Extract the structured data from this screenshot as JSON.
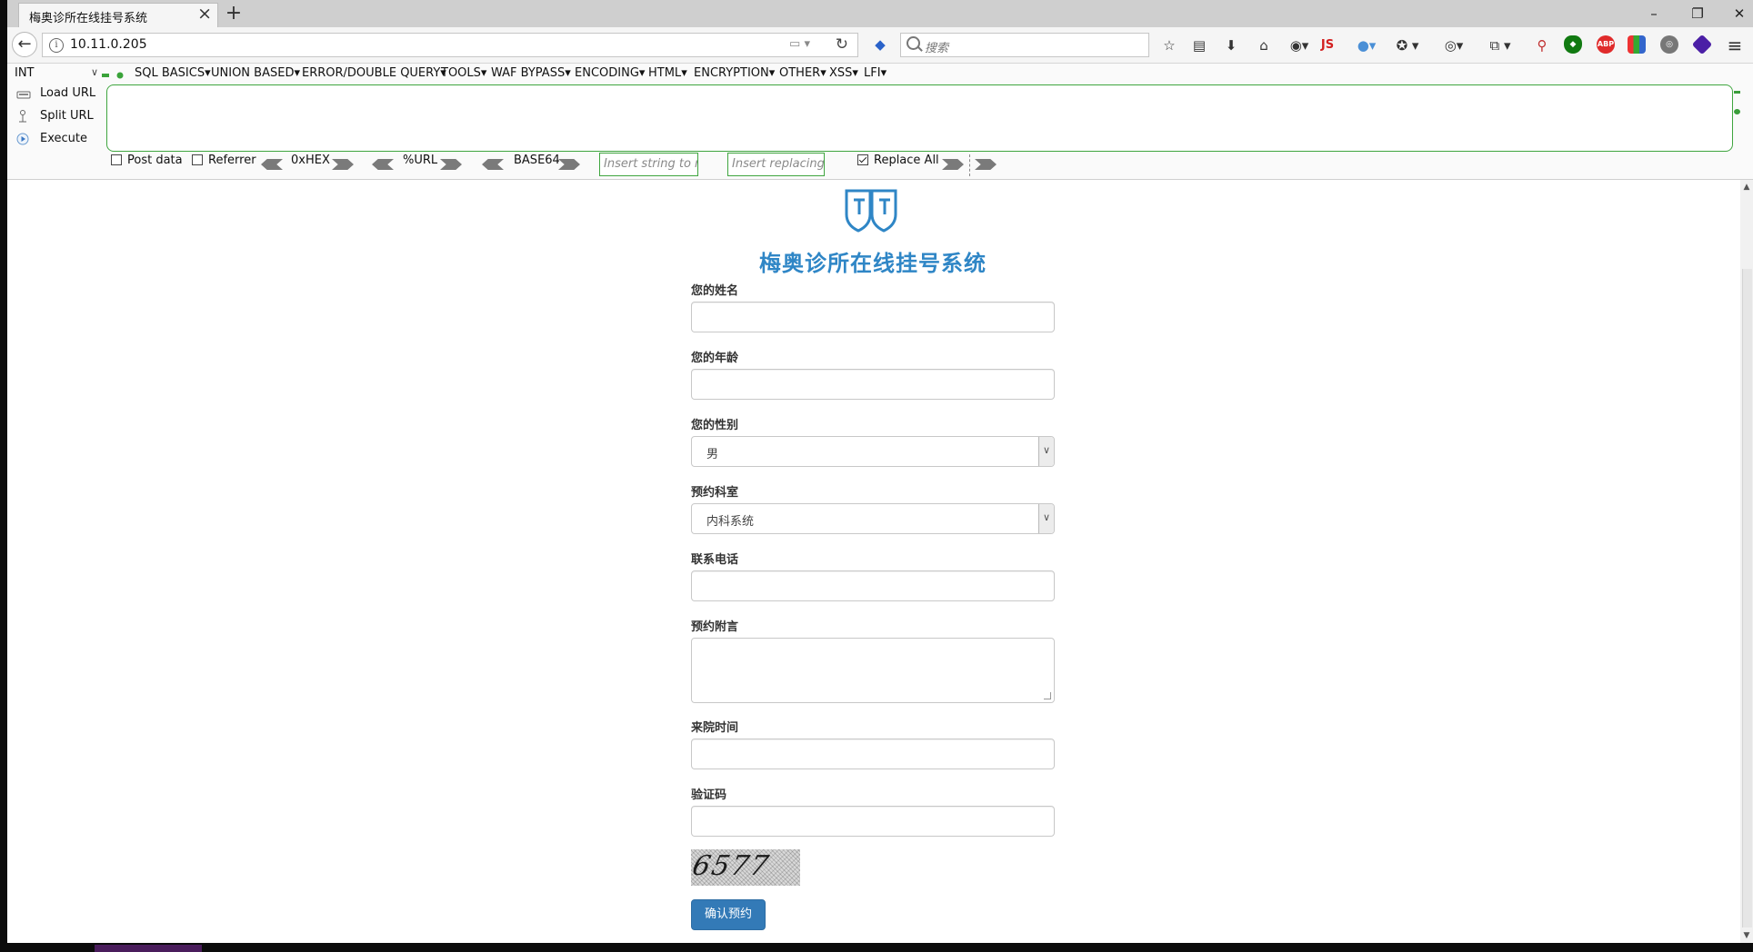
{
  "tab": {
    "title": "梅奥诊所在线挂号系统"
  },
  "window": {
    "minimize": "–",
    "restore": "❐",
    "close": "✕"
  },
  "navbar": {
    "url": "10.11.0.205",
    "search_placeholder": "搜索",
    "js_label": "JS",
    "abp_label": "ABP"
  },
  "hackbar": {
    "select_value": "INT",
    "menu": [
      "SQL BASICS",
      "UNION BASED",
      "ERROR/DOUBLE QUERY",
      "TOOLS",
      "WAF BYPASS",
      "ENCODING",
      "HTML",
      "ENCRYPTION",
      "OTHER",
      "XSS",
      "LFI"
    ],
    "load_url": "Load URL",
    "split_url": "Split URL",
    "execute": "Execute",
    "post_data": "Post data",
    "referrer": "Referrer",
    "hex": "0xHEX",
    "url_enc": "%URL",
    "base64": "BASE64",
    "replace_from_placeholder": "Insert string to replace",
    "replace_to_placeholder": "Insert replacing string",
    "replace_all": "Replace All",
    "post_data_checked": false,
    "referrer_checked": false,
    "replace_all_checked": true
  },
  "page": {
    "title": "梅奥诊所在线挂号系统",
    "fields": {
      "name_label": "您的姓名",
      "age_label": "您的年龄",
      "gender_label": "您的性别",
      "gender_value": "男",
      "dept_label": "预约科室",
      "dept_value": "内科系统",
      "phone_label": "联系电话",
      "note_label": "预约附言",
      "time_label": "来院时间",
      "captcha_label": "验证码",
      "captcha_code": "6577"
    },
    "submit_label": "确认预约",
    "accent_color": "#2f86c6",
    "button_color": "#337ab7"
  }
}
